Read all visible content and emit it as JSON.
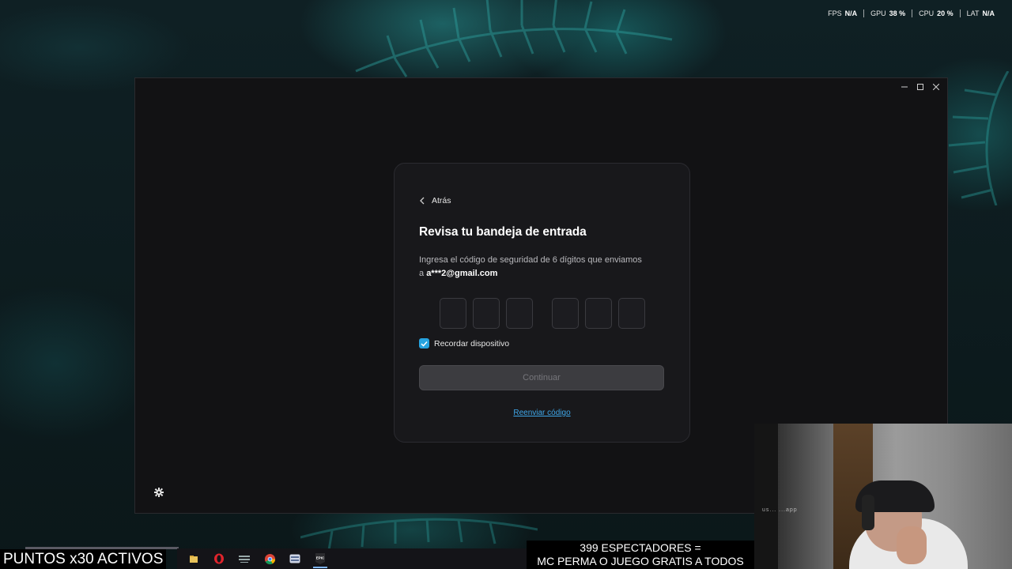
{
  "overlay": {
    "fps_label": "FPS",
    "fps_value": "N/A",
    "gpu_label": "GPU",
    "gpu_value": "38 %",
    "cpu_label": "CPU",
    "cpu_value": "20 %",
    "lat_label": "LAT",
    "lat_value": "N/A"
  },
  "login_card": {
    "back_label": "Atrás",
    "title": "Revisa tu bandeja de entrada",
    "description": "Ingresa el código de seguridad de 6 dígitos que enviamos",
    "description_prefix": "a",
    "email": "a***2@gmail.com",
    "code_digits": [
      "",
      "",
      "",
      "",
      "",
      ""
    ],
    "remember_label": "Recordar dispositivo",
    "remember_checked": true,
    "continue_label": "Continuar",
    "resend_label": "Reenviar código"
  },
  "stream_overlay": {
    "points_banner": "PUNTOS x30 ACTIVOS",
    "viewers_line1": "399 ESPECTADORES =",
    "viewers_line2": "MC PERMA O JUEGO GRATIS A TODOS",
    "webcam_watermark": "us... ...app"
  },
  "taskbar": {
    "icons": [
      "file-explorer-icon",
      "opera-browser-icon",
      "lunar-client-icon",
      "chrome-icon",
      "app-window-icon",
      "epic-games-icon"
    ],
    "epic_label": "EPIC"
  },
  "colors": {
    "accent": "#3fa6e8",
    "checkbox": "#26a3e0",
    "card_bg": "#18181b",
    "window_bg": "#121214"
  }
}
